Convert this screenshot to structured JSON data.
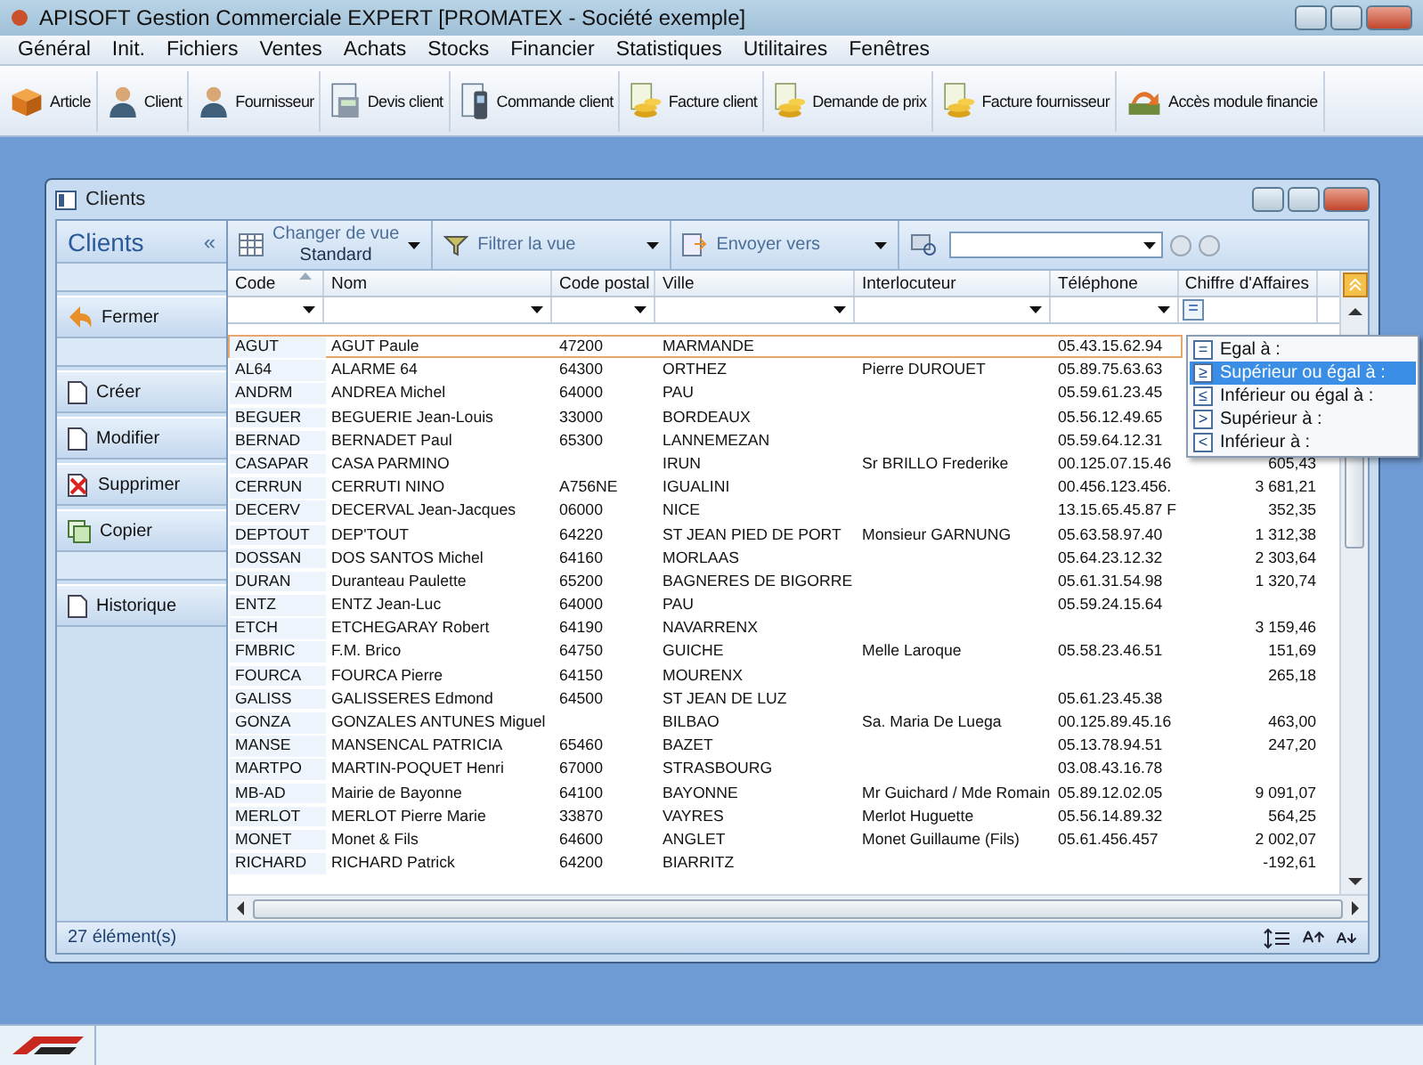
{
  "window": {
    "title": "APISOFT Gestion Commerciale EXPERT [PROMATEX - Société exemple]"
  },
  "menu": [
    "Général",
    "Init.",
    "Fichiers",
    "Ventes",
    "Achats",
    "Stocks",
    "Financier",
    "Statistiques",
    "Utilitaires",
    "Fenêtres"
  ],
  "toolbar": [
    "Article",
    "Client",
    "Fournisseur",
    "Devis client",
    "Commande client",
    "Facture client",
    "Demande de prix",
    "Facture fournisseur",
    "Accès module financie"
  ],
  "child": {
    "title": "Clients"
  },
  "sidebar": {
    "title": "Clients",
    "collapse": "«",
    "actions": [
      "Fermer",
      "Créer",
      "Modifier",
      "Supprimer",
      "Copier",
      "Historique"
    ]
  },
  "view_toolbar": {
    "view_label": "Changer de vue",
    "view_value": "Standard",
    "filter": "Filtrer la vue",
    "send": "Envoyer vers"
  },
  "table": {
    "columns": [
      {
        "label": "Code",
        "sorted": true
      },
      {
        "label": "Nom",
        "sorted": false
      },
      {
        "label": "Code postal",
        "sorted": false
      },
      {
        "label": "Ville",
        "sorted": false
      },
      {
        "label": "Interlocuteur",
        "sorted": false
      },
      {
        "label": "Téléphone",
        "sorted": false
      },
      {
        "label": "Chiffre d'Affaires",
        "sorted": false
      }
    ],
    "rows": [
      {
        "selected": true,
        "cells": [
          "AGUT",
          "AGUT Paule",
          "47200",
          "MARMANDE",
          null,
          "05.43.15.62.94",
          null
        ]
      },
      {
        "selected": false,
        "cells": [
          "AL64",
          "ALARME 64",
          "64300",
          "ORTHEZ",
          "Pierre DUROUET",
          "05.89.75.63.63",
          null
        ]
      },
      {
        "selected": false,
        "cells": [
          "ANDRM",
          "ANDREA Michel",
          "64000",
          "PAU",
          null,
          "05.59.61.23.45",
          null
        ]
      },
      {
        "selected": false,
        "cells": [
          "BEGUER",
          "BEGUERIE Jean-Louis",
          "33000",
          "BORDEAUX",
          null,
          "05.56.12.49.65",
          null
        ]
      },
      {
        "selected": false,
        "cells": [
          "BERNAD",
          "BERNADET Paul",
          "65300",
          "LANNEMEZAN",
          null,
          "05.59.64.12.31",
          null
        ]
      },
      {
        "selected": false,
        "cells": [
          "CASAPAR",
          "CASA PARMINO",
          null,
          "IRUN",
          "Sr BRILLO Frederike",
          "00.125.07.15.46",
          "605,43"
        ]
      },
      {
        "selected": false,
        "cells": [
          "CERRUN",
          "CERRUTI NINO",
          "A756NE",
          "IGUALINI",
          null,
          "00.456.123.456.",
          "3 681,21"
        ]
      },
      {
        "selected": false,
        "cells": [
          "DECERV",
          "DECERVAL Jean-Jacques",
          "06000",
          "NICE",
          null,
          "13.15.65.45.87 F",
          "352,35"
        ]
      },
      {
        "selected": false,
        "cells": [
          "DEPTOUT",
          "DEP'TOUT",
          "64220",
          "ST JEAN PIED DE PORT",
          "Monsieur GARNUNG",
          "05.63.58.97.40",
          "1 312,38"
        ]
      },
      {
        "selected": false,
        "cells": [
          "DOSSAN",
          "DOS SANTOS Michel",
          "64160",
          "MORLAAS",
          null,
          "05.64.23.12.32",
          "2 303,64"
        ]
      },
      {
        "selected": false,
        "cells": [
          "DURAN",
          "Duranteau Paulette",
          "65200",
          "BAGNERES DE BIGORRE",
          null,
          "05.61.31.54.98",
          "1 320,74"
        ]
      },
      {
        "selected": false,
        "cells": [
          "ENTZ",
          "ENTZ Jean-Luc",
          "64000",
          "PAU",
          null,
          "05.59.24.15.64",
          null
        ]
      },
      {
        "selected": false,
        "cells": [
          "ETCH",
          "ETCHEGARAY Robert",
          "64190",
          "NAVARRENX",
          null,
          null,
          "3 159,46"
        ]
      },
      {
        "selected": false,
        "cells": [
          "FMBRIC",
          "F.M. Brico",
          "64750",
          "GUICHE",
          "Melle Laroque",
          "05.58.23.46.51",
          "151,69"
        ]
      },
      {
        "selected": false,
        "cells": [
          "FOURCA",
          "FOURCA Pierre",
          "64150",
          "MOURENX",
          null,
          null,
          "265,18"
        ]
      },
      {
        "selected": false,
        "cells": [
          "GALISS",
          "GALISSERES Edmond",
          "64500",
          "ST JEAN DE LUZ",
          null,
          "05.61.23.45.38",
          null
        ]
      },
      {
        "selected": false,
        "cells": [
          "GONZA",
          "GONZALES ANTUNES Miguel",
          null,
          "BILBAO",
          "Sa. Maria De Luega",
          "00.125.89.45.16",
          "463,00"
        ]
      },
      {
        "selected": false,
        "cells": [
          "MANSE",
          "MANSENCAL PATRICIA",
          "65460",
          "BAZET",
          null,
          "05.13.78.94.51",
          "247,20"
        ]
      },
      {
        "selected": false,
        "cells": [
          "MARTPO",
          "MARTIN-POQUET Henri",
          "67000",
          "STRASBOURG",
          null,
          "03.08.43.16.78",
          null
        ]
      },
      {
        "selected": false,
        "cells": [
          "MB-AD",
          "Mairie de Bayonne",
          "64100",
          "BAYONNE",
          "Mr Guichard / Mde Romain",
          "05.89.12.02.05",
          "9 091,07"
        ]
      },
      {
        "selected": false,
        "cells": [
          "MERLOT",
          "MERLOT Pierre Marie",
          "33870",
          "VAYRES",
          "Merlot Huguette",
          "05.56.14.89.32",
          "564,25"
        ]
      },
      {
        "selected": false,
        "cells": [
          "MONET",
          "Monet & Fils",
          "64600",
          "ANGLET",
          "Monet Guillaume (Fils)",
          "05.61.456.457",
          "2 002,07"
        ]
      },
      {
        "selected": false,
        "cells": [
          "RICHARD",
          "RICHARD Patrick",
          "64200",
          "BIARRITZ",
          null,
          null,
          "-192,61"
        ]
      }
    ]
  },
  "filter_menu": {
    "button": "=",
    "options": [
      {
        "symbol": "=",
        "label": "Egal à :",
        "selected": false
      },
      {
        "symbol": "≥",
        "label": "Supérieur ou égal à :",
        "selected": true
      },
      {
        "symbol": "≤",
        "label": "Inférieur ou égal à :",
        "selected": false
      },
      {
        "symbol": ">",
        "label": "Supérieur à :",
        "selected": false
      },
      {
        "symbol": "<",
        "label": "Inférieur à :",
        "selected": false
      }
    ]
  },
  "status": {
    "count": "27 élément(s)"
  }
}
